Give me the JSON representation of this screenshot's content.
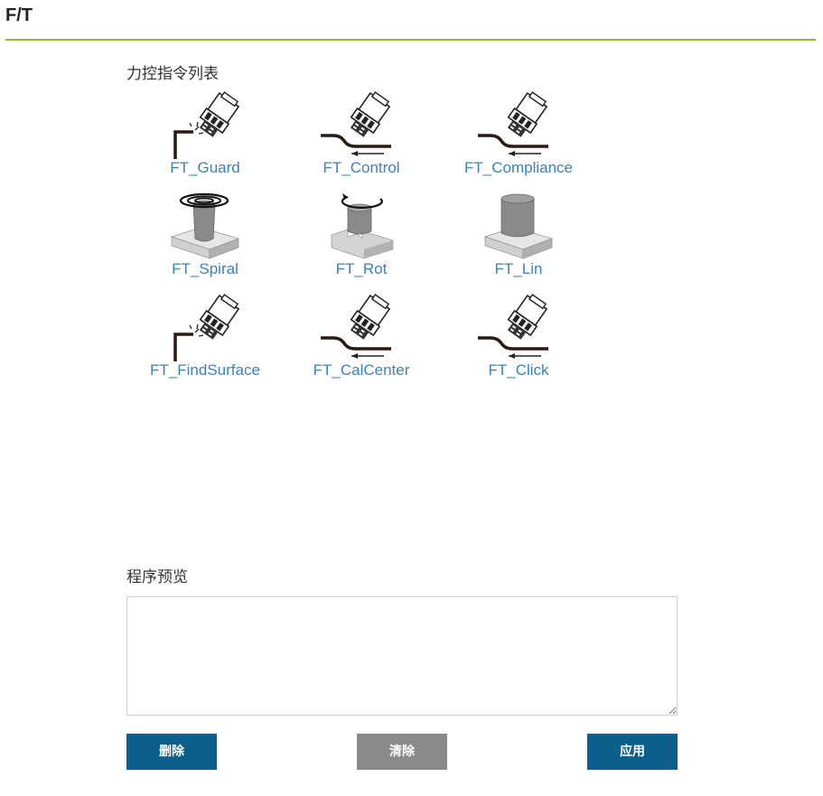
{
  "header": {
    "title": "F/T"
  },
  "commands": {
    "label": "力控指令列表",
    "items": [
      {
        "name": "FT_Guard",
        "icon": "force-guard-corner-icon"
      },
      {
        "name": "FT_Control",
        "icon": "force-control-slope-icon"
      },
      {
        "name": "FT_Compliance",
        "icon": "force-compliance-slope-icon"
      },
      {
        "name": "FT_Spiral",
        "icon": "spiral-insert-icon"
      },
      {
        "name": "FT_Rot",
        "icon": "rotation-insert-icon"
      },
      {
        "name": "FT_Lin",
        "icon": "linear-insert-icon"
      },
      {
        "name": "FT_FindSurface",
        "icon": "find-surface-corner-icon"
      },
      {
        "name": "FT_CalCenter",
        "icon": "calibrate-center-slope-icon"
      },
      {
        "name": "FT_Click",
        "icon": "click-slope-icon"
      }
    ]
  },
  "preview": {
    "label": "程序预览",
    "value": ""
  },
  "buttons": {
    "delete": "删除",
    "clear": "清除",
    "apply": "应用"
  },
  "colors": {
    "accent": "#8fbc3a",
    "link": "#3b82bc",
    "primary": "#0d5e8c",
    "neutral": "#8a8a8a"
  }
}
